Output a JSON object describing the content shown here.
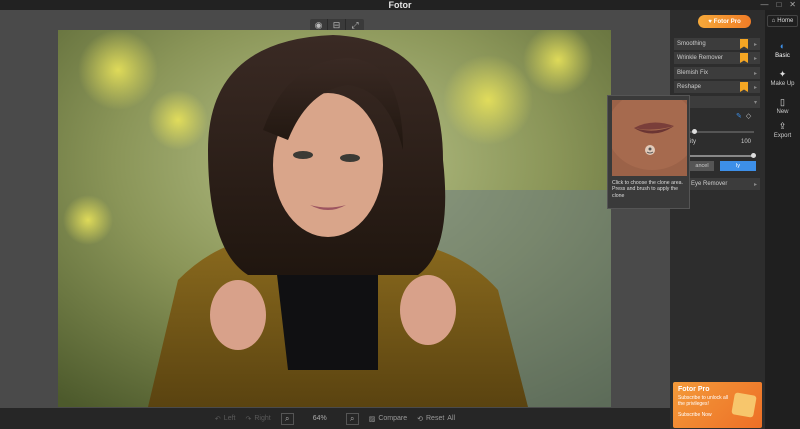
{
  "window": {
    "title": "Fotor",
    "minimize_label": "—",
    "maximize_label": "□",
    "close_label": "✕"
  },
  "canvas_toolbar": {
    "eye_icon": "eye-icon",
    "compare_split_icon": "split-icon",
    "zoom_icon": "zoom-icon"
  },
  "bottombar": {
    "left_label": "Left",
    "right_label": "Right",
    "zoom_value": "64%",
    "compare_label": "Compare",
    "reset_label": "Reset",
    "all_label": "All"
  },
  "panel": {
    "pro_button": "Fotor Pro",
    "tools": [
      {
        "label": "Smoothing",
        "pro": true
      },
      {
        "label": "Wrinkle Remover",
        "pro": true
      },
      {
        "label": "Blemish Fix",
        "pro": false
      },
      {
        "label": "Reshape",
        "pro": true
      }
    ],
    "intensity_label": "ity",
    "intensity_value": "100",
    "cancel_label": "ancel",
    "apply_label": "ly",
    "red_eye_label": "Eye Remover",
    "ad": {
      "title": "Fotor Pro",
      "subtitle": "Subscribe to unlock all the privileges!",
      "cta": "Subscribe Now"
    }
  },
  "sidebar": {
    "home_label": "Home",
    "items": [
      {
        "label": "Basic",
        "icon": "brush-icon",
        "active": true
      },
      {
        "label": "Make Up",
        "icon": "makeup-icon",
        "active": false
      },
      {
        "label": "New",
        "icon": "new-file-icon",
        "active": false
      },
      {
        "label": "Export",
        "icon": "export-icon",
        "active": false
      }
    ]
  },
  "tooltip": {
    "text": "Click to choose the clone area. Press and brush to apply the clone"
  },
  "colors": {
    "accent_blue": "#3d8fe8",
    "pro_orange": "#f17d27",
    "crown_gold": "#f5a623"
  }
}
